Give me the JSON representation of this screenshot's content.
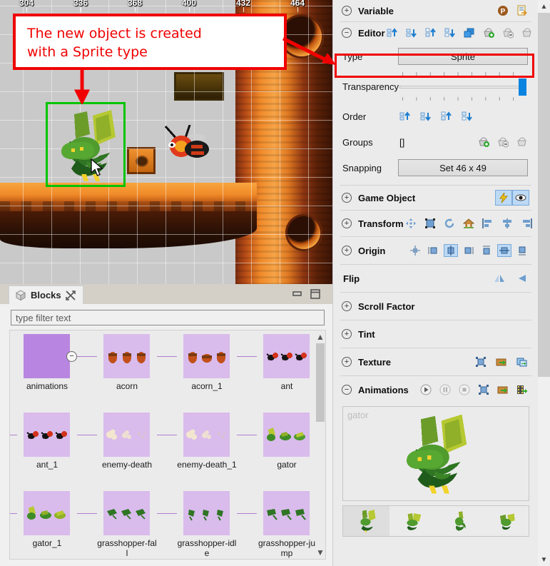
{
  "scene": {
    "ruler_labels": [
      "304",
      "336",
      "368",
      "400",
      "432",
      "464"
    ],
    "annotation": {
      "line1": "The new object is created",
      "line2": "with a Sprite type",
      "color": "#f00000"
    },
    "selection_color": "#00c400"
  },
  "blocks": {
    "tab_label": "Blocks",
    "filter_placeholder": "type filter text",
    "minimize_label": "Minimize",
    "maximize_label": "Maximize",
    "items": [
      {
        "label": "animations",
        "kind": "folder"
      },
      {
        "label": "acorn",
        "kind": "sprite"
      },
      {
        "label": "acorn_1",
        "kind": "sprite"
      },
      {
        "label": "ant",
        "kind": "sprite"
      },
      {
        "label": "ant_1",
        "kind": "sprite"
      },
      {
        "label": "enemy-death",
        "kind": "sprite"
      },
      {
        "label": "enemy-death_1",
        "kind": "sprite"
      },
      {
        "label": "gator",
        "kind": "sprite"
      },
      {
        "label": "gator_1",
        "kind": "sprite"
      },
      {
        "label": "grasshopper-fall",
        "kind": "sprite"
      },
      {
        "label": "grasshopper-idle",
        "kind": "sprite"
      },
      {
        "label": "grasshopper-jump",
        "kind": "sprite"
      }
    ]
  },
  "inspector": {
    "sections": {
      "variable": {
        "title": "Variable",
        "expanded": false,
        "tools": [
          "prefab-badge-icon",
          "export-document-icon"
        ]
      },
      "editor": {
        "title": "Editor",
        "expanded": true,
        "tools": [
          "align-top-icon",
          "align-bottom-icon",
          "distribute-up-icon",
          "distribute-down-icon",
          "duplicate-icon",
          "group-add-icon",
          "group-remove-icon",
          "group-clear-icon"
        ],
        "type_label": "Type",
        "type_value": "Sprite",
        "transparency_label": "Transparency",
        "transparency_value": 100,
        "order_label": "Order",
        "order_tools": [
          "move-up-icon",
          "move-down-icon",
          "move-top-icon",
          "move-bottom-icon"
        ],
        "groups_label": "Groups",
        "groups_value": "[]",
        "groups_tools": [
          "group-add-icon",
          "group-remove-icon",
          "group-clear-icon"
        ],
        "snapping_label": "Snapping",
        "snapping_value": "Set 46 x 49"
      },
      "game_object": {
        "title": "Game Object",
        "expanded": false,
        "tools": [
          "lightning-icon",
          "eye-icon"
        ]
      },
      "transform": {
        "title": "Transform",
        "expanded": false,
        "tools": [
          "move-tool-icon",
          "scale-tool-icon",
          "rotate-tool-icon",
          "home-icon",
          "align-left-icon",
          "align-center-icon",
          "align-right-icon"
        ]
      },
      "origin": {
        "title": "Origin",
        "expanded": false,
        "tools": [
          "origin-center-icon",
          "origin-left-icon",
          "origin-hcenter-icon",
          "origin-right-icon",
          "origin-top-icon",
          "origin-vcenter-icon",
          "origin-bottom-icon"
        ],
        "active": [
          "origin-hcenter-icon",
          "origin-vcenter-icon"
        ]
      },
      "flip": {
        "title": "Flip",
        "expanded": null,
        "tools": [
          "flip-horizontal-icon",
          "flip-vertical-icon"
        ]
      },
      "scroll_factor": {
        "title": "Scroll Factor",
        "expanded": false,
        "tools": []
      },
      "tint": {
        "title": "Tint",
        "expanded": false,
        "tools": []
      },
      "texture": {
        "title": "Texture",
        "expanded": false,
        "tools": [
          "select-texture-icon",
          "open-package-icon",
          "copy-texture-icon"
        ]
      },
      "animations": {
        "title": "Animations",
        "expanded": true,
        "tools": [
          "play-icon",
          "pause-icon",
          "stop-icon",
          "select-texture-icon",
          "open-package-icon",
          "export-film-icon"
        ],
        "preview_name": "gator",
        "frame_count": 4,
        "selected_frame": 0
      }
    }
  }
}
